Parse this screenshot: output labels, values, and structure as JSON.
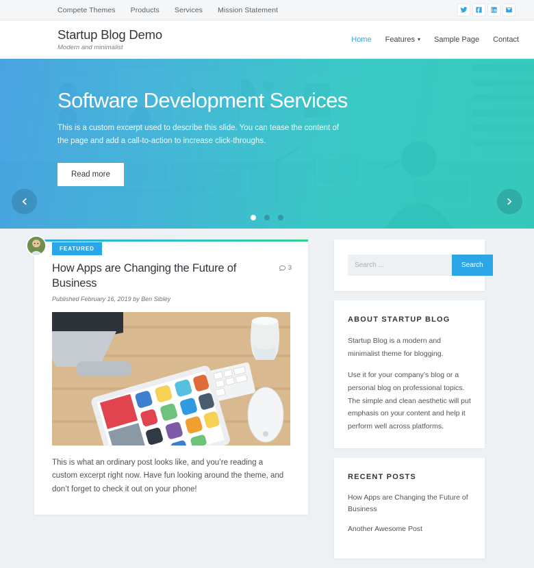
{
  "topbar": {
    "menu": [
      {
        "label": "Compete Themes"
      },
      {
        "label": "Products"
      },
      {
        "label": "Services"
      },
      {
        "label": "Mission Statement"
      }
    ],
    "social": [
      {
        "name": "twitter-icon",
        "label": "Twitter"
      },
      {
        "name": "facebook-icon",
        "label": "Facebook"
      },
      {
        "name": "linkedin-icon",
        "label": "LinkedIn"
      },
      {
        "name": "email-icon",
        "label": "Email"
      }
    ]
  },
  "header": {
    "site_title": "Startup Blog Demo",
    "site_description": "Modern and minimalist",
    "nav": [
      {
        "label": "Home",
        "active": true
      },
      {
        "label": "Features",
        "has_dropdown": true,
        "caret": "▾"
      },
      {
        "label": "Sample Page"
      },
      {
        "label": "Contact"
      }
    ]
  },
  "hero": {
    "title": "Software Development Services",
    "text": "This is a custom excerpt used to describe this slide. You can tease the content of the page and add a call-to-action to increase click-throughs.",
    "button_label": "Read more",
    "prev_label": "Previous slide",
    "next_label": "Next slide",
    "slides_total": 3,
    "active_slide": 1,
    "gradient_start": "#3e9ee0",
    "gradient_end": "#2ac8b8"
  },
  "post": {
    "badge": "FEATURED",
    "title": "How Apps are Changing the Future of Business",
    "meta": "Published February 16, 2019 by Ben Sibley",
    "comment_count": "3",
    "excerpt": "This is what an ordinary post looks like, and you’re reading a custom excerpt right now. Have fun looking around the theme, and don’t forget to check it out on your phone!",
    "image_alt": "Desk with iMac, keyboard, tablet showing app store, mouse and glass of water",
    "accent": "#2ba7e8"
  },
  "sidebar": {
    "search": {
      "placeholder": "Search ...",
      "button_label": "Search"
    },
    "about": {
      "title": "ABOUT STARTUP BLOG",
      "paragraphs": [
        "Startup Blog is a modern and minimalist theme for blogging.",
        "Use it for your company’s blog or a personal blog on professional topics. The simple and clean aesthetic will put emphasis on your content and help it perform well across platforms."
      ]
    },
    "recent": {
      "title": "RECENT POSTS",
      "items": [
        {
          "label": "How Apps are Changing the Future of Business"
        },
        {
          "label": "Another Awesome Post"
        }
      ]
    }
  }
}
